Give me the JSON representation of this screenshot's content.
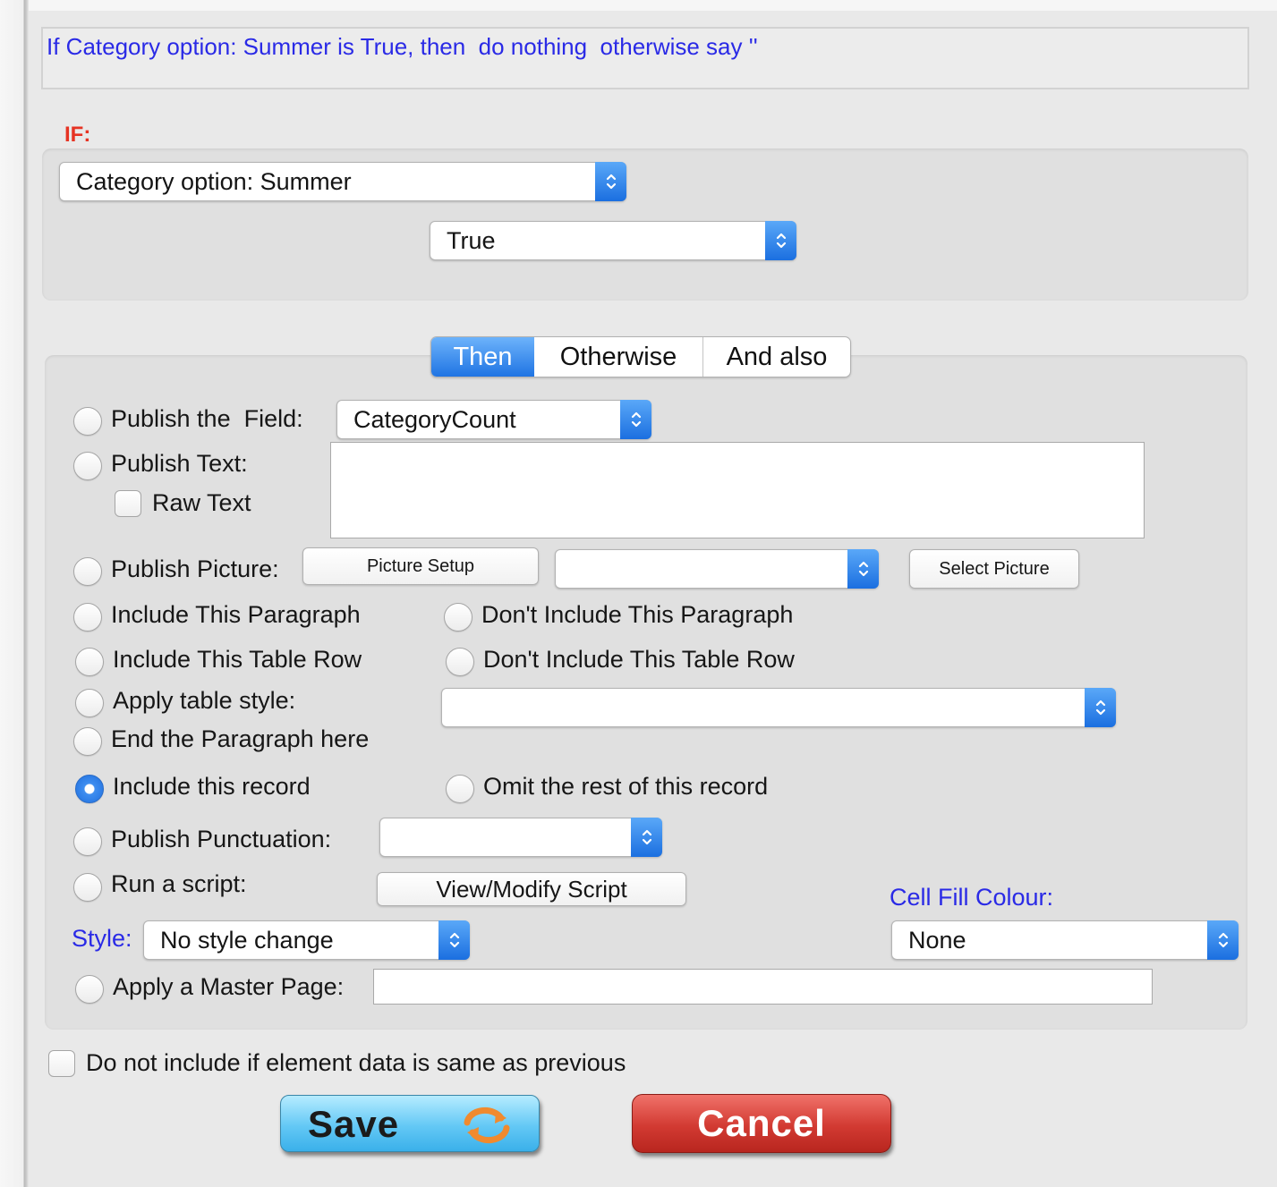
{
  "summary": "If Category option: Summer is True, then  do nothing  otherwise say ''",
  "if_section": {
    "label": "IF:",
    "condition_field": "Category option: Summer",
    "condition_value": "True"
  },
  "tabs": [
    {
      "label": "Then",
      "active": true
    },
    {
      "label": "Otherwise",
      "active": false
    },
    {
      "label": "And also",
      "active": false
    }
  ],
  "actions": {
    "publish_field": {
      "label": "Publish the  Field:",
      "value": "CategoryCount",
      "selected": false
    },
    "publish_text": {
      "label": "Publish Text:",
      "value": "",
      "selected": false
    },
    "raw_text": {
      "label": "Raw Text",
      "checked": false
    },
    "publish_picture": {
      "label": "Publish Picture:",
      "setup_button": "Picture Setup",
      "value": "",
      "select_button": "Select Picture",
      "selected": false
    },
    "include_paragraph": {
      "label": "Include This Paragraph",
      "selected": false
    },
    "dont_include_paragraph": {
      "label": "Don't Include This Paragraph",
      "selected": false
    },
    "include_table_row": {
      "label": "Include This Table Row",
      "selected": false
    },
    "dont_include_table_row": {
      "label": "Don't Include This Table Row",
      "selected": false
    },
    "apply_table_style": {
      "label": "Apply table style:",
      "value": "",
      "selected": false
    },
    "end_paragraph": {
      "label": "End the Paragraph here",
      "selected": false
    },
    "include_record": {
      "label": "Include this record",
      "selected": true
    },
    "omit_record": {
      "label": "Omit the rest of this record",
      "selected": false
    },
    "publish_punctuation": {
      "label": "Publish Punctuation:",
      "value": "",
      "selected": false
    },
    "run_script": {
      "label": "Run a script:",
      "button": "View/Modify Script",
      "selected": false
    },
    "style": {
      "label": "Style:",
      "value": "No style change"
    },
    "cell_fill": {
      "label": "Cell Fill Colour:",
      "value": "None"
    },
    "master_page": {
      "label": "Apply a Master Page:",
      "value": "",
      "selected": false
    }
  },
  "no_repeat": {
    "label": "Do not include if element data is same as previous",
    "checked": false
  },
  "buttons": {
    "save": "Save",
    "cancel": "Cancel"
  },
  "colors": {
    "accent": "#1f74e3",
    "blue_text": "#2a2ae6",
    "if_red": "#e63323",
    "save": "#63c8f5",
    "cancel": "#d23a32"
  },
  "icons": {
    "popup": "updown-chevron-icon",
    "save": "refresh-arrows-icon"
  }
}
